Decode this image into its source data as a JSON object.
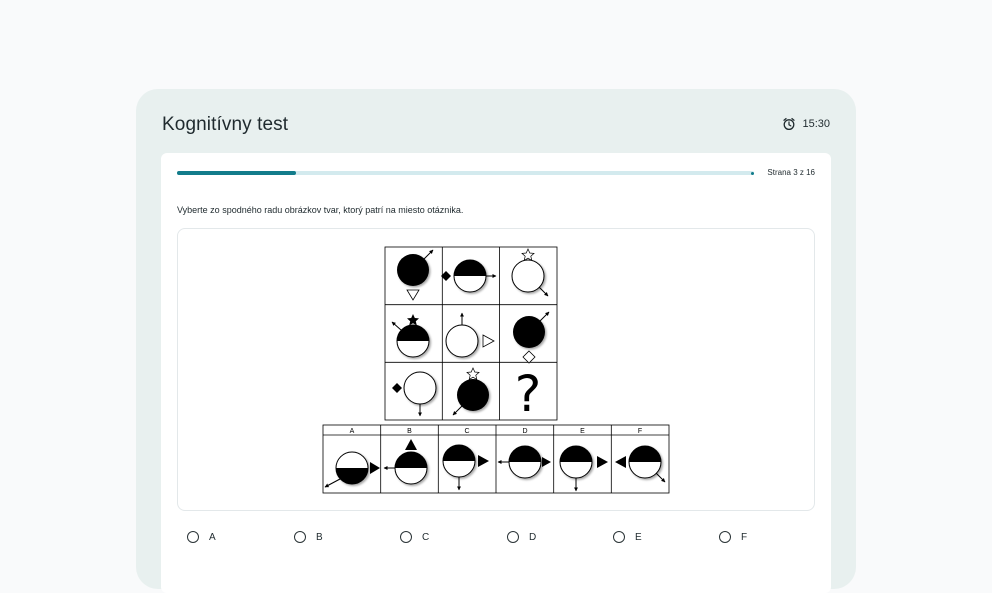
{
  "app": {
    "title": "Kognitívny test"
  },
  "timer": {
    "icon": "alarm-clock-icon",
    "value": "15:30"
  },
  "progress": {
    "fraction": 0.206,
    "label": "Strana 3 z 16",
    "accent": "#127c8b",
    "track": "#d3eaee"
  },
  "question": {
    "instruction": "Vyberte zo spodného radu obrázkov tvar, ktorý patrí na miesto otáznika."
  },
  "puzzle": {
    "missing_symbol": "?",
    "choice_labels": [
      "A",
      "B",
      "C",
      "D",
      "E",
      "F"
    ]
  },
  "answers": [
    {
      "label": "A"
    },
    {
      "label": "B"
    },
    {
      "label": "C"
    },
    {
      "label": "D"
    },
    {
      "label": "E"
    },
    {
      "label": "F"
    }
  ]
}
